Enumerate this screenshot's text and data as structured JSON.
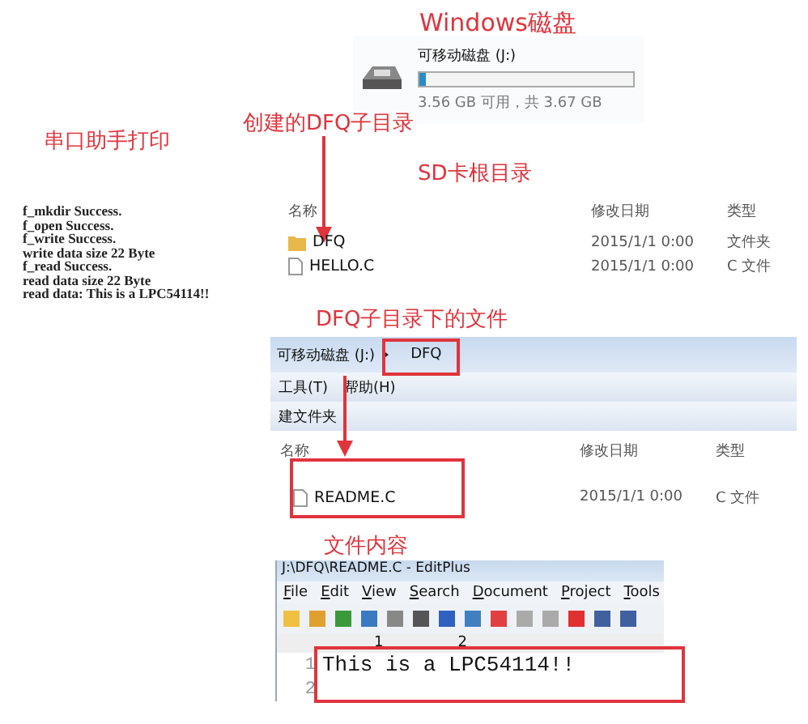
{
  "annotations": {
    "disk": "Windows磁盘",
    "serial": "串口助手打印",
    "created": "创建的DFQ子目录",
    "root": "SD卡根目录",
    "subdir": "DFQ子目录下的文件",
    "content": "文件内容"
  },
  "drive": {
    "name": "可移动磁盘 (J:)",
    "level": 0.03,
    "free": "3.56 GB 可用，共 3.67 GB"
  },
  "console": [
    "f_mkdir Success.",
    "f_open Success.",
    "f_write Success.",
    "write data size 22 Byte",
    "f_read Success.",
    "read data size 22 Byte",
    "read data: This is a LPC54114!!"
  ],
  "root_list": {
    "columns": [
      "名称",
      "修改日期",
      "类型"
    ],
    "rows": [
      {
        "kind": "folder",
        "name": "DFQ",
        "date": "2015/1/1 0:00",
        "type": "文件夹"
      },
      {
        "kind": "file",
        "name": "HELLO.C",
        "date": "2015/1/1 0:00",
        "type": "C 文件"
      }
    ]
  },
  "subdir_window": {
    "path": [
      "可移动磁盘 (J:)",
      "DFQ"
    ],
    "menu": [
      "工具(T)",
      "帮助(H)"
    ],
    "toolbar": "建文件夹",
    "columns": [
      "名称",
      "修改日期",
      "类型"
    ],
    "rows": [
      {
        "kind": "file",
        "name": "README.C",
        "date": "2015/1/1 0:00",
        "type": "C 文件"
      }
    ]
  },
  "editor": {
    "title": "J:\\DFQ\\README.C - EditPlus",
    "menu": [
      "File",
      "Edit",
      "View",
      "Search",
      "Document",
      "Project",
      "Tools"
    ],
    "ruler": [
      "1",
      "2"
    ],
    "lines": [
      {
        "number": "1",
        "text": "This is a LPC54114!!"
      },
      {
        "number": "2"
      }
    ]
  }
}
